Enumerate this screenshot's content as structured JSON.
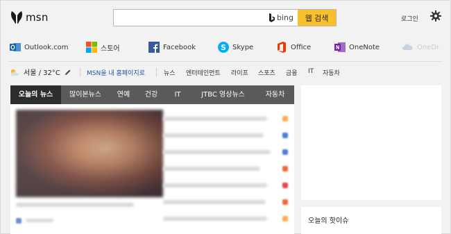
{
  "header": {
    "logo_text": "msn",
    "search": {
      "placeholder": "",
      "bing_label": "bing",
      "button_label": "웹 검색"
    },
    "login_label": "로그인"
  },
  "apps": [
    {
      "label": "Outlook.com",
      "icon": "outlook-icon"
    },
    {
      "label": "스토어",
      "icon": "store-icon"
    },
    {
      "label": "Facebook",
      "icon": "facebook-icon"
    },
    {
      "label": "Skype",
      "icon": "skype-icon"
    },
    {
      "label": "Office",
      "icon": "office-icon"
    },
    {
      "label": "OneNote",
      "icon": "onenote-icon"
    },
    {
      "label": "OneDr",
      "icon": "onedrive-icon"
    }
  ],
  "weather": {
    "text": "서울 / 32°C"
  },
  "homepage_link": "MSN을 내 홈페이지로",
  "categories": [
    "뉴스",
    "엔터테인먼트",
    "라이프",
    "스포츠",
    "금융",
    "IT",
    "자동차"
  ],
  "news_tabs": [
    "오늘의 뉴스",
    "많이본뉴스",
    "연예",
    "건강",
    "IT",
    "JTBC 영상뉴스",
    "자동차"
  ],
  "right": {
    "hot_issue_title": "오늘의 핫이슈"
  },
  "colors": {
    "accent_yellow": "#f9c02c",
    "link_blue": "#1f56a5",
    "tab_bar": "#5a5a5a",
    "tab_active": "#2d2d2d"
  }
}
